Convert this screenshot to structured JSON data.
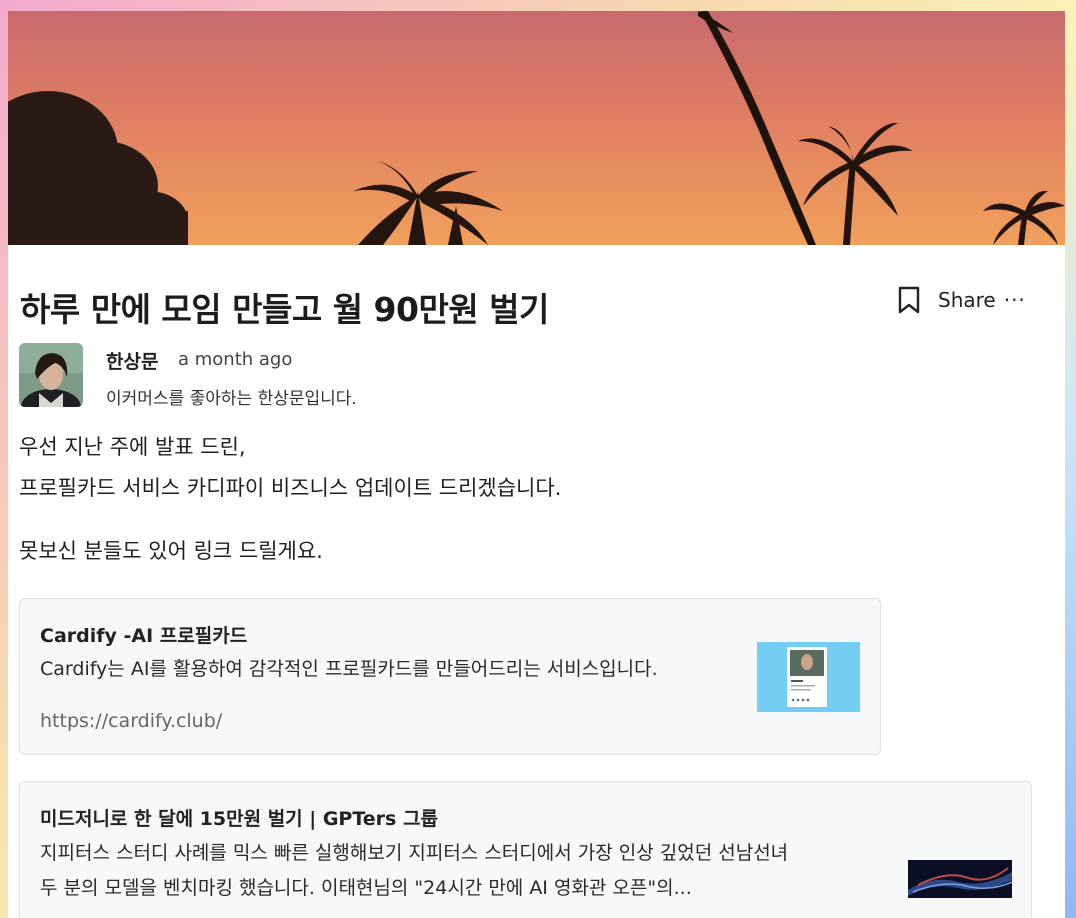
{
  "post": {
    "title": "하루 만에 모임 만들고 월 90만원 벌기",
    "share_label": "Share",
    "more_label": "···"
  },
  "author": {
    "name": "한상문",
    "time": "a month ago",
    "bio": "이커머스를 좋아하는 한상문입니다."
  },
  "body": {
    "paragraph_1_line_1": "우선 지난 주에 발표 드린,",
    "paragraph_1_line_2": "프로필카드 서비스 카디파이 비즈니스 업데이트 드리겠습니다.",
    "paragraph_2": "못보신 분들도 있어 링크 드릴게요."
  },
  "link_cards": [
    {
      "title": "Cardify -AI 프로필카드",
      "description": "Cardify는 AI를 활용하여 감각적인 프로필카드를 만들어드리는 서비스입니다.",
      "url": "https://cardify.club/"
    },
    {
      "title": "미드저니로 한 달에 15만원 벌기 | GPTers 그룹",
      "description_line_1": "지피터스 스터디 사례를 믹스 빠른 실행해보기 지피터스 스터디에서 가장 인상 깊었던 선남선녀",
      "description_line_2": "두 분의 모델을 벤치마킹 했습니다. 이태현님의 \"24시간 만에 AI 영화관 오픈\"의..."
    }
  ],
  "icons": {
    "bookmark": "bookmark-icon",
    "more": "more-horizontal-icon"
  },
  "colors": {
    "text_primary": "#1c1c1c",
    "card_background": "#f6f8fa",
    "card_border": "#dde2e7",
    "link_gray": "#666666"
  }
}
